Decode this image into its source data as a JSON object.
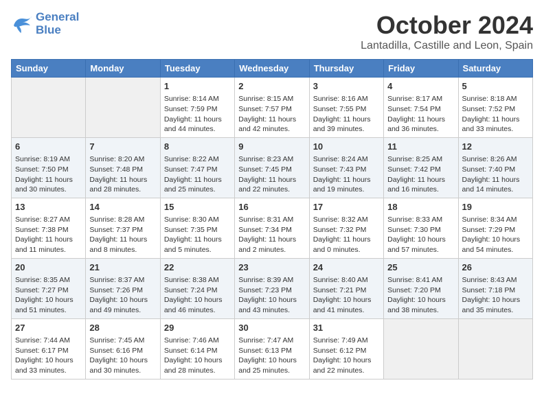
{
  "header": {
    "logo_line1": "General",
    "logo_line2": "Blue",
    "month": "October 2024",
    "location": "Lantadilla, Castille and Leon, Spain"
  },
  "days_of_week": [
    "Sunday",
    "Monday",
    "Tuesday",
    "Wednesday",
    "Thursday",
    "Friday",
    "Saturday"
  ],
  "weeks": [
    [
      {
        "day": "",
        "info": ""
      },
      {
        "day": "",
        "info": ""
      },
      {
        "day": "1",
        "info": "Sunrise: 8:14 AM\nSunset: 7:59 PM\nDaylight: 11 hours and 44 minutes."
      },
      {
        "day": "2",
        "info": "Sunrise: 8:15 AM\nSunset: 7:57 PM\nDaylight: 11 hours and 42 minutes."
      },
      {
        "day": "3",
        "info": "Sunrise: 8:16 AM\nSunset: 7:55 PM\nDaylight: 11 hours and 39 minutes."
      },
      {
        "day": "4",
        "info": "Sunrise: 8:17 AM\nSunset: 7:54 PM\nDaylight: 11 hours and 36 minutes."
      },
      {
        "day": "5",
        "info": "Sunrise: 8:18 AM\nSunset: 7:52 PM\nDaylight: 11 hours and 33 minutes."
      }
    ],
    [
      {
        "day": "6",
        "info": "Sunrise: 8:19 AM\nSunset: 7:50 PM\nDaylight: 11 hours and 30 minutes."
      },
      {
        "day": "7",
        "info": "Sunrise: 8:20 AM\nSunset: 7:48 PM\nDaylight: 11 hours and 28 minutes."
      },
      {
        "day": "8",
        "info": "Sunrise: 8:22 AM\nSunset: 7:47 PM\nDaylight: 11 hours and 25 minutes."
      },
      {
        "day": "9",
        "info": "Sunrise: 8:23 AM\nSunset: 7:45 PM\nDaylight: 11 hours and 22 minutes."
      },
      {
        "day": "10",
        "info": "Sunrise: 8:24 AM\nSunset: 7:43 PM\nDaylight: 11 hours and 19 minutes."
      },
      {
        "day": "11",
        "info": "Sunrise: 8:25 AM\nSunset: 7:42 PM\nDaylight: 11 hours and 16 minutes."
      },
      {
        "day": "12",
        "info": "Sunrise: 8:26 AM\nSunset: 7:40 PM\nDaylight: 11 hours and 14 minutes."
      }
    ],
    [
      {
        "day": "13",
        "info": "Sunrise: 8:27 AM\nSunset: 7:38 PM\nDaylight: 11 hours and 11 minutes."
      },
      {
        "day": "14",
        "info": "Sunrise: 8:28 AM\nSunset: 7:37 PM\nDaylight: 11 hours and 8 minutes."
      },
      {
        "day": "15",
        "info": "Sunrise: 8:30 AM\nSunset: 7:35 PM\nDaylight: 11 hours and 5 minutes."
      },
      {
        "day": "16",
        "info": "Sunrise: 8:31 AM\nSunset: 7:34 PM\nDaylight: 11 hours and 2 minutes."
      },
      {
        "day": "17",
        "info": "Sunrise: 8:32 AM\nSunset: 7:32 PM\nDaylight: 11 hours and 0 minutes."
      },
      {
        "day": "18",
        "info": "Sunrise: 8:33 AM\nSunset: 7:30 PM\nDaylight: 10 hours and 57 minutes."
      },
      {
        "day": "19",
        "info": "Sunrise: 8:34 AM\nSunset: 7:29 PM\nDaylight: 10 hours and 54 minutes."
      }
    ],
    [
      {
        "day": "20",
        "info": "Sunrise: 8:35 AM\nSunset: 7:27 PM\nDaylight: 10 hours and 51 minutes."
      },
      {
        "day": "21",
        "info": "Sunrise: 8:37 AM\nSunset: 7:26 PM\nDaylight: 10 hours and 49 minutes."
      },
      {
        "day": "22",
        "info": "Sunrise: 8:38 AM\nSunset: 7:24 PM\nDaylight: 10 hours and 46 minutes."
      },
      {
        "day": "23",
        "info": "Sunrise: 8:39 AM\nSunset: 7:23 PM\nDaylight: 10 hours and 43 minutes."
      },
      {
        "day": "24",
        "info": "Sunrise: 8:40 AM\nSunset: 7:21 PM\nDaylight: 10 hours and 41 minutes."
      },
      {
        "day": "25",
        "info": "Sunrise: 8:41 AM\nSunset: 7:20 PM\nDaylight: 10 hours and 38 minutes."
      },
      {
        "day": "26",
        "info": "Sunrise: 8:43 AM\nSunset: 7:18 PM\nDaylight: 10 hours and 35 minutes."
      }
    ],
    [
      {
        "day": "27",
        "info": "Sunrise: 7:44 AM\nSunset: 6:17 PM\nDaylight: 10 hours and 33 minutes."
      },
      {
        "day": "28",
        "info": "Sunrise: 7:45 AM\nSunset: 6:16 PM\nDaylight: 10 hours and 30 minutes."
      },
      {
        "day": "29",
        "info": "Sunrise: 7:46 AM\nSunset: 6:14 PM\nDaylight: 10 hours and 28 minutes."
      },
      {
        "day": "30",
        "info": "Sunrise: 7:47 AM\nSunset: 6:13 PM\nDaylight: 10 hours and 25 minutes."
      },
      {
        "day": "31",
        "info": "Sunrise: 7:49 AM\nSunset: 6:12 PM\nDaylight: 10 hours and 22 minutes."
      },
      {
        "day": "",
        "info": ""
      },
      {
        "day": "",
        "info": ""
      }
    ]
  ]
}
